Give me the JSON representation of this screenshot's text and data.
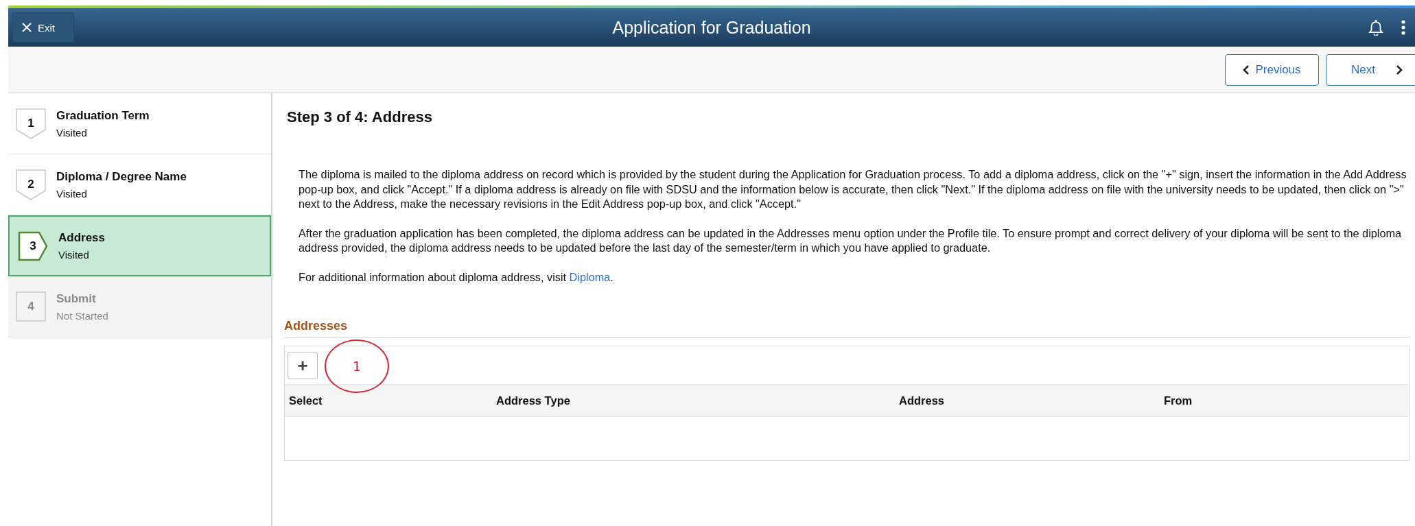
{
  "header": {
    "exit_label": "Exit",
    "title": "Application for Graduation"
  },
  "nav": {
    "previous": "Previous",
    "next": "Next"
  },
  "steps": [
    {
      "number": "1",
      "title": "Graduation Term",
      "status": "Visited",
      "selected": false,
      "disabled": false
    },
    {
      "number": "2",
      "title": "Diploma / Degree Name",
      "status": "Visited",
      "selected": false,
      "disabled": false
    },
    {
      "number": "3",
      "title": "Address",
      "status": "Visited",
      "selected": true,
      "disabled": false
    },
    {
      "number": "4",
      "title": "Submit",
      "status": "Not Started",
      "selected": false,
      "disabled": true
    }
  ],
  "content": {
    "heading": "Step 3 of 4: Address",
    "paragraphs": [
      "The diploma is mailed to the diploma address on record which is provided by the student during the Application for Graduation process. To add a diploma address, click on the \"+\" sign, insert the information in the Add Address pop-up box, and click \"Accept.\" If a diploma address is already on file with SDSU and the information below is accurate, then click \"Next.\" If the diploma address on file with the university needs to be updated, then click on \">\" next to the Address, make the necessary revisions in the Edit Address pop-up box, and click \"Accept.\"",
      "After the graduation application has been completed, the diploma address can be updated in the Addresses menu option under the Profile tile. To ensure prompt and correct delivery of your diploma will be sent to the diploma address provided, the diploma address needs to be updated before the last day of the semester/term in which you have applied to graduate."
    ],
    "more_info": {
      "text": "For additional information about diploma address, visit ",
      "link": "Diploma",
      "suffix": "."
    },
    "addresses": {
      "title": "Addresses",
      "add_label": "+",
      "annotation": "1",
      "columns": [
        "Select",
        "Address Type",
        "Address",
        "From"
      ]
    }
  }
}
